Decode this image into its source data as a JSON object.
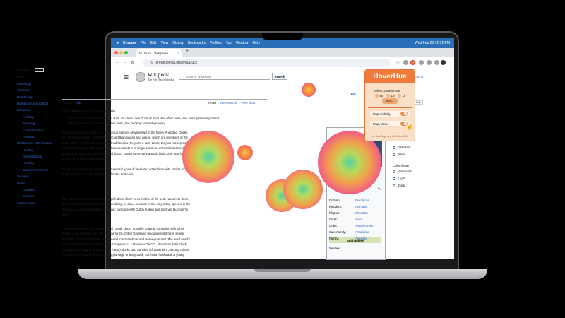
{
  "menubar": {
    "items": [
      "Chrome",
      "File",
      "Edit",
      "View",
      "History",
      "Bookmarks",
      "Profiles",
      "Tab",
      "Window",
      "Help"
    ],
    "clock": "Wed Feb 28  12:52 PM"
  },
  "browser": {
    "tab_title": "Duck - Wikipedia",
    "tab_close": "×",
    "new_tab": "+",
    "url": "en.wikipedia.org/wiki/Duck"
  },
  "wiki": {
    "wordmark": "Wikipedia",
    "tagline": "The Free Encyclopedia",
    "search_placeholder": "Search Wikipedia",
    "search_button": "Search",
    "top_links": "ount  Log in",
    "contents": {
      "heading": "Contents",
      "hide": "hide",
      "items": [
        {
          "label": "(Top)",
          "sub": false
        },
        {
          "label": "Etymology",
          "sub": false
        },
        {
          "label": "Taxonomy",
          "sub": false
        },
        {
          "label": "Morphology",
          "sub": false
        },
        {
          "label": "Distribution and habitat",
          "sub": false
        },
        {
          "label": "Behaviour",
          "sub": false
        },
        {
          "label": "Feeding",
          "sub": true
        },
        {
          "label": "Breeding",
          "sub": true
        },
        {
          "label": "Communication",
          "sub": true
        },
        {
          "label": "Predators",
          "sub": true
        },
        {
          "label": "Relationship with humans",
          "sub": false
        },
        {
          "label": "Hunting",
          "sub": true
        },
        {
          "label": "Domestication",
          "sub": true
        },
        {
          "label": "Heraldry",
          "sub": true
        },
        {
          "label": "Cultural references",
          "sub": true
        },
        {
          "label": "See also",
          "sub": false
        },
        {
          "label": "Notes",
          "sub": false
        },
        {
          "label": "Citations",
          "sub": true
        },
        {
          "label": "Sources",
          "sub": true
        },
        {
          "label": "External links",
          "sub": false
        }
      ]
    },
    "article": {
      "title": "Duck",
      "lang": "138 l",
      "tab_article": "Article",
      "tab_talk": "Talk",
      "tab_read": "Read",
      "tab_view_source": "View source",
      "tab_history": "View histo",
      "from": "From Wikipedia, the free encyclopedia",
      "hatnote_1": "This article is about the bird. For duck as a food, see Duck as food. For other uses, see Duck (disambiguation).",
      "hatnote_2": "\"Ducking\" redirects here. For other uses, see Ducking (disambiguation).",
      "p1_lines": [
        "Duck is the common name for numerous species of waterfowl in the family Anatidae. Ducks",
        "are generally smaller and shorter-necked than swans and geese, which are members of the",
        "same family. Divided among several subfamilies, they are a form taxon; they do not represent a",
        "monophyletic group (the group of all descendants of a single common ancestral species), since",
        "swans and geese are not considered ducks. Ducks are mostly aquatic birds, and may be found",
        "in both fresh water and sea water."
      ],
      "p2_lines": [
        "Ducks are sometimes confused with several types of unrelated water birds with similar forms,",
        "such as loons or divers, grebes, gallinules and coots."
      ],
      "etymology_heading": "Etymology",
      "p3_lines": [
        "The word duck comes from Old English dūce 'diver', a derivative of the verb *dūcan 'to duck,",
        "bend down low as if to get under something, or dive', because of the way many species in the",
        "dabbling duck group feed by upending; compare with Dutch duiken and German tauchen 'to",
        "dive'."
      ],
      "p4_lines": [
        "This word replaced Old English ened / ænid 'duck', possibly to avoid confusion with other",
        "words, such as ende 'end' with similar forms. Other Germanic languages still have similar",
        "words for duck, for example, Dutch eend, German Ente and Norwegian and. The word ened /",
        "ænid was inherited from Proto-Indo-European; cf. Latin anas \"duck\", Lithuanian ántis 'duck',",
        "Ancient Greek νῆσσα /νῆττα (nēssa /nētta) 'duck', and Sanskrit ātí 'water bird', among others.",
        "A duckling is a young duck in downy plumage or baby duck, but in the food trade a young"
      ]
    },
    "infobox": {
      "rows": [
        {
          "key": "Domain:",
          "value": "Eukaryota"
        },
        {
          "key": "Kingdom:",
          "value": "Animalia"
        },
        {
          "key": "Phylum:",
          "value": "Chordata"
        },
        {
          "key": "Class:",
          "value": "Aves"
        },
        {
          "key": "Order:",
          "value": "Anseriformes"
        },
        {
          "key": "Superfamily:",
          "value": "Anatoidea"
        },
        {
          "key": "Family:",
          "value": "Anatidae"
        }
      ],
      "subfamilies": "Subfamilies",
      "see_text": "See text"
    },
    "appearance": {
      "hide": "hide",
      "width_label": "Width",
      "width_options": [
        {
          "label": "Standard",
          "on": true
        },
        {
          "label": "Wide",
          "on": false
        }
      ],
      "color_label": "Color (beta)",
      "color_options": [
        {
          "label": "Automatic",
          "on": false
        },
        {
          "label": "Light",
          "on": true
        },
        {
          "label": "Dark",
          "on": false
        }
      ]
    }
  },
  "hoverhue": {
    "title": "HoverHue",
    "growth_label": "Select Growth Rate:",
    "rates": [
      "5s",
      "1m",
      "1h"
    ],
    "enter": "Enter",
    "map_visibility": "Map Visibility",
    "map_active": "Map Active",
    "footer": "by Kate Doge and Will Chiu 2024"
  },
  "colors": {
    "accent": "#ef7a3c",
    "wiki_link": "#3366cc",
    "menubar": "#2a6fb8"
  }
}
